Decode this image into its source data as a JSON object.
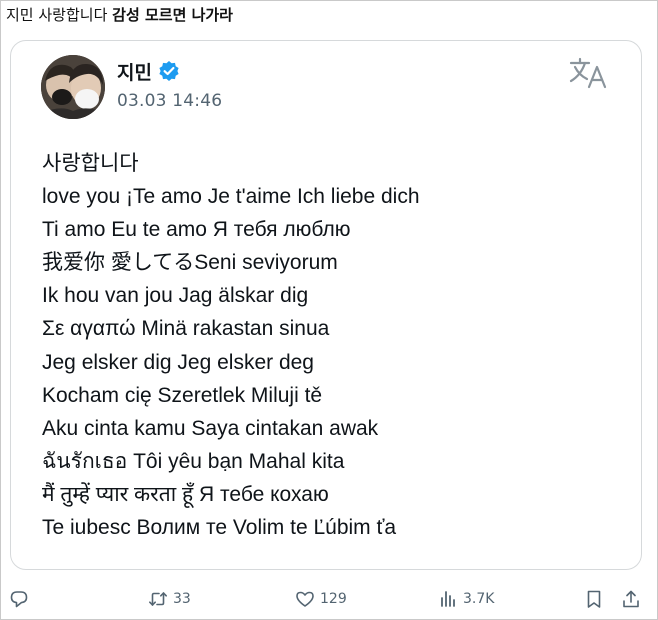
{
  "caption": {
    "prefix": "지민 사랑합니다 ",
    "bold": "감성 모르면 나가라"
  },
  "post": {
    "author": "지민",
    "timestamp": "03.03 14:46",
    "lines": [
      "사랑합니다",
      "love you ¡Te amo Je t'aime Ich liebe dich",
      "Ti amo Eu te amo Я тебя люблю",
      "我爱你 愛してるSeni seviyorum",
      "Ik hou van jou Jag älskar dig",
      "Σε αγαπώ Minä rakastan sinua",
      "Jeg elsker dig Jeg elsker deg",
      "Kocham cię Szeretlek Miluji tě",
      "Aku cinta kamu Saya cintakan awak",
      "ฉันรักเธอ Tôi yêu bạn Mahal kita",
      "मैं तुम्हें प्यार करता हूँ   Я тебе кохаю",
      "Te iubesc Волим те Volim te Ľúbim ťa"
    ]
  },
  "actions": {
    "retweets": "33",
    "likes": "129",
    "views": "3.7K"
  },
  "colors": {
    "verified": "#1d9bf0",
    "muted": "#536471",
    "text": "#0f1419",
    "border": "#d6d9db"
  },
  "icons": [
    "verified-badge-icon",
    "translate-icon",
    "reply-icon",
    "retweet-icon",
    "like-icon",
    "views-icon",
    "bookmark-icon",
    "share-icon"
  ]
}
